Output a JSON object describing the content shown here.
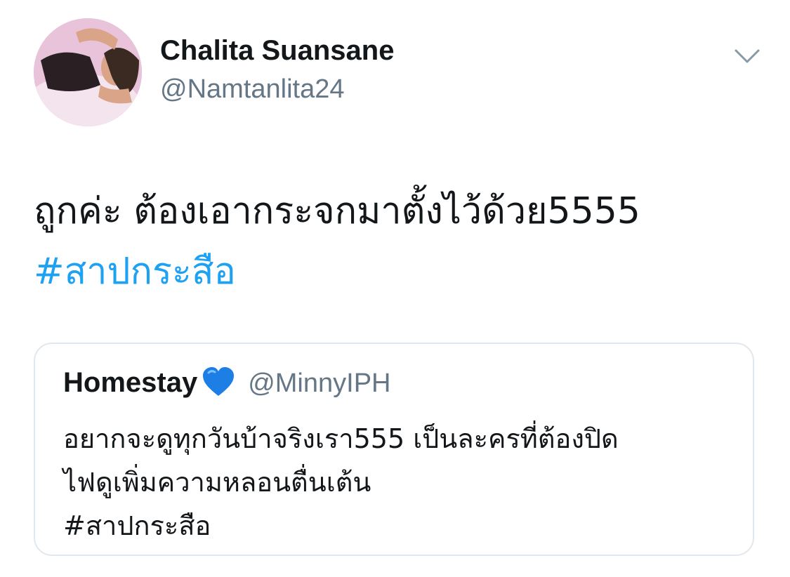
{
  "author": {
    "display_name": "Chalita Suansane",
    "handle": "@Namtanlita24",
    "avatar_icon": "profile-photo"
  },
  "menu_icon": "chevron-down-icon",
  "tweet": {
    "text_line1": "ถูกค่ะ ต้องเอากระจกมาตั้งไว้ด้วย5555",
    "hashtag": "#สาปกระสือ"
  },
  "quoted_tweet": {
    "display_name": "Homestay",
    "emoji": "blue-heart-icon",
    "handle": "@MinnyIPH",
    "text_line1": "อยากจะดูทุกวันบ้าจริงเรา555 เป็นละครที่ต้องปิด",
    "text_line2": "ไฟดูเพิ่มความหลอนตื่นเต้น",
    "hashtag": "#สาปกระสือ"
  },
  "colors": {
    "link": "#1da1f2",
    "secondary_text": "#657786",
    "border": "#e1e8ed",
    "heart": "#1d7fe6"
  }
}
